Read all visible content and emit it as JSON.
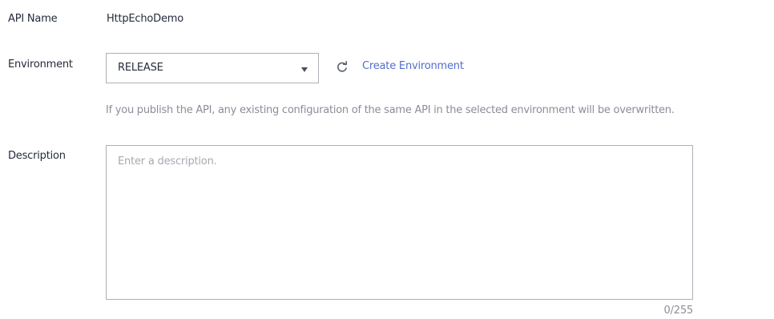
{
  "form": {
    "api_name": {
      "label": "API Name",
      "value": "HttpEchoDemo"
    },
    "environment": {
      "label": "Environment",
      "selected": "RELEASE",
      "refresh_icon": "refresh-icon",
      "dropdown_icon": "caret-down-icon",
      "create_link": "Create Environment",
      "hint": "If you publish the API, any existing configuration of the same API in the selected environment will be overwritten."
    },
    "description": {
      "label": "Description",
      "placeholder": "Enter a description.",
      "counter": "0/255"
    }
  },
  "colors": {
    "text": "#252b3a",
    "muted": "#8a8e99",
    "link": "#526ecc",
    "border": "#adb0b8"
  }
}
